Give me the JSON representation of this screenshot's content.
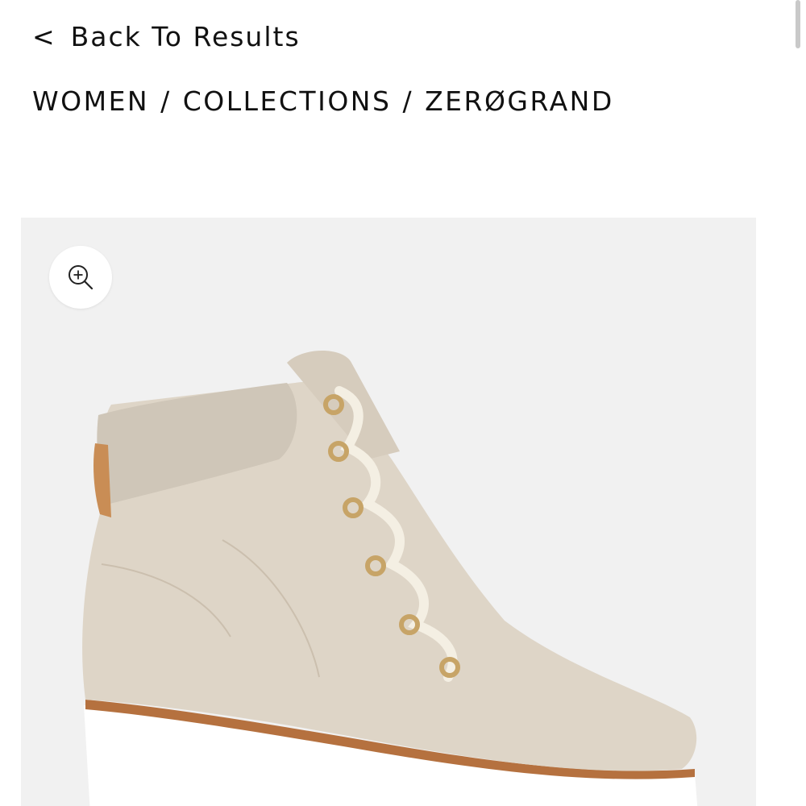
{
  "nav": {
    "back_label": "Back To Results",
    "back_chevron": "<"
  },
  "breadcrumb": {
    "items": [
      "WOMEN",
      "COLLECTIONS",
      "ZERØGRAND"
    ],
    "separator": "/"
  },
  "gallery": {
    "zoom_icon": "zoom-in-icon",
    "image_subject": "boot",
    "colors": {
      "suede": "#ded5c7",
      "collar": "#cfc6b8",
      "sole": "#ffffff",
      "welt": "#b5713f",
      "heel_tab": "#c98d55",
      "hardware": "#c7a467",
      "laces": "#f4efe3"
    }
  }
}
